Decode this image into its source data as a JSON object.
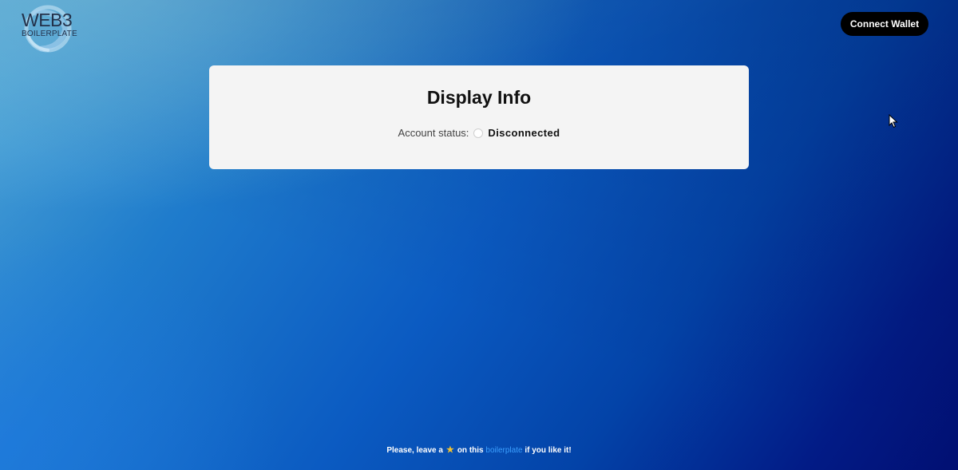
{
  "header": {
    "logo_word": "WEB3",
    "logo_sub": "BOILERPLATE",
    "connect_label": "Connect Wallet"
  },
  "card": {
    "title": "Display Info",
    "status_label": "Account status:",
    "status_value": "Disconnected"
  },
  "footer": {
    "text_before": "Please, leave a",
    "star_icon": "star-icon",
    "text_middle": "on this",
    "link_text": "boilerplate",
    "text_after": "if you like it!"
  },
  "colors": {
    "button_bg": "#000000",
    "card_bg": "#f4f4f4",
    "link": "#3ca0ff",
    "star": "#f2c230"
  }
}
